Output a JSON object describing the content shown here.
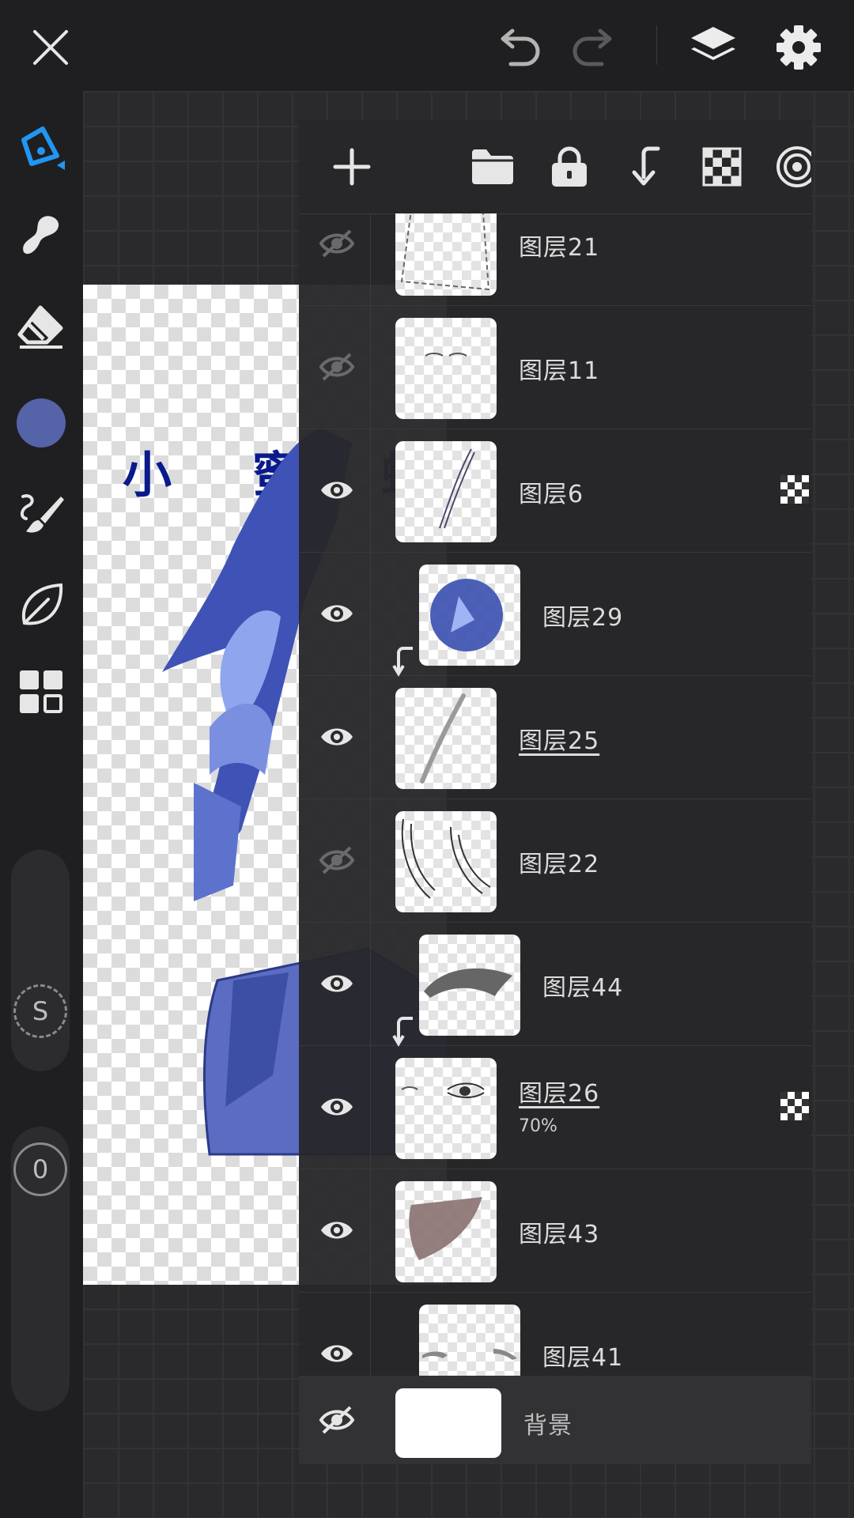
{
  "doc_title": "小 蜜 蜂 嗡 嗡 嗡 .",
  "layers": [
    {
      "name": "图层21",
      "visible": false,
      "clipped": false,
      "underline": false,
      "opacity": "",
      "mask": false
    },
    {
      "name": "图层11",
      "visible": false,
      "clipped": false,
      "underline": false,
      "opacity": "",
      "mask": false
    },
    {
      "name": "图层6",
      "visible": true,
      "clipped": false,
      "underline": false,
      "opacity": "",
      "mask": true
    },
    {
      "name": "图层29",
      "visible": true,
      "clipped": true,
      "underline": false,
      "opacity": "",
      "mask": false
    },
    {
      "name": "图层25",
      "visible": true,
      "clipped": false,
      "underline": true,
      "opacity": "",
      "mask": false
    },
    {
      "name": "图层22",
      "visible": false,
      "clipped": false,
      "underline": false,
      "opacity": "",
      "mask": false
    },
    {
      "name": "图层44",
      "visible": true,
      "clipped": true,
      "underline": false,
      "opacity": "",
      "mask": false
    },
    {
      "name": "图层26",
      "visible": true,
      "clipped": false,
      "underline": true,
      "opacity": "70%",
      "mask": true
    },
    {
      "name": "图层43",
      "visible": true,
      "clipped": false,
      "underline": false,
      "opacity": "",
      "mask": false
    },
    {
      "name": "图层41",
      "visible": true,
      "clipped": true,
      "underline": false,
      "opacity": "",
      "mask": false
    }
  ],
  "background_layer": {
    "name": "背景",
    "visible": false
  },
  "left_sliders": {
    "size_label": "S",
    "opacity_label": "0"
  },
  "colors": {
    "accent": "#2196f3",
    "current_color": "#5563a8",
    "doc_title": "#0a1a8c"
  }
}
